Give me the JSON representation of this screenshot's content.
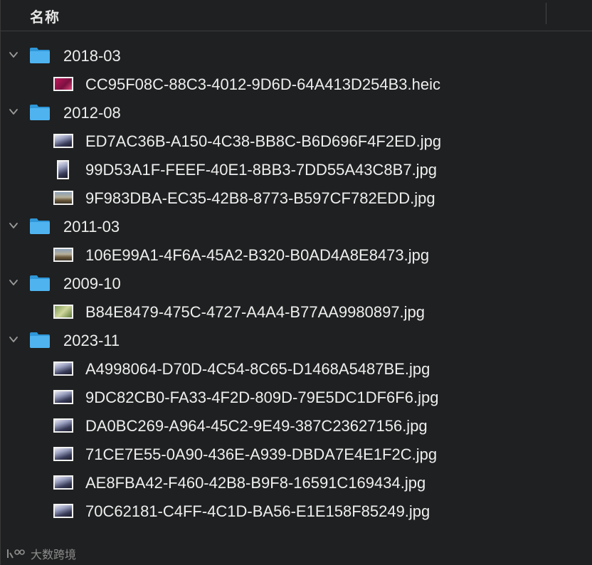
{
  "header": {
    "name_column": "名称"
  },
  "groups": [
    {
      "folder": "2018-03",
      "files": [
        {
          "name": "CC95F08C-88C3-4012-9D6D-64A413D254B3.heic",
          "thumb": "flower-thumbnail",
          "orientation": "landscape"
        }
      ]
    },
    {
      "folder": "2012-08",
      "files": [
        {
          "name": "ED7AC36B-A150-4C38-BB8C-B6D696F4F2ED.jpg",
          "thumb": "image-thumbnail",
          "orientation": "landscape"
        },
        {
          "name": "99D53A1F-FEEF-40E1-8BB3-7DD55A43C8B7.jpg",
          "thumb": "image-thumbnail",
          "orientation": "portrait"
        },
        {
          "name": "9F983DBA-EC35-42B8-8773-B597CF782EDD.jpg",
          "thumb": "landscape-thumbnail",
          "orientation": "landscape"
        }
      ]
    },
    {
      "folder": "2011-03",
      "files": [
        {
          "name": "106E99A1-4F6A-45A2-B320-B0AD4A8E8473.jpg",
          "thumb": "landscape-thumbnail",
          "orientation": "landscape"
        }
      ]
    },
    {
      "folder": "2009-10",
      "files": [
        {
          "name": "B84E8479-475C-4727-A4A4-B77AA9980897.jpg",
          "thumb": "nature-thumbnail",
          "orientation": "landscape"
        }
      ]
    },
    {
      "folder": "2023-11",
      "files": [
        {
          "name": "A4998064-D70D-4C54-8C65-D1468A5487BE.jpg",
          "thumb": "image-thumbnail",
          "orientation": "landscape"
        },
        {
          "name": "9DC82CB0-FA33-4F2D-809D-79E5DC1DF6F6.jpg",
          "thumb": "image-thumbnail",
          "orientation": "landscape"
        },
        {
          "name": "DA0BC269-A964-45C2-9E49-387C23627156.jpg",
          "thumb": "image-thumbnail",
          "orientation": "landscape"
        },
        {
          "name": "71CE7E55-0A90-436E-A939-DBDA7E4E1F2C.jpg",
          "thumb": "image-thumbnail",
          "orientation": "landscape"
        },
        {
          "name": "AE8FBA42-F460-42B8-B9F8-16591C169434.jpg",
          "thumb": "image-thumbnail",
          "orientation": "landscape"
        },
        {
          "name": "70C62181-C4FF-4C1D-BA56-E1E158F85249.jpg",
          "thumb": "image-thumbnail",
          "orientation": "landscape"
        }
      ]
    }
  ],
  "watermark": {
    "text": "大数跨境"
  },
  "colors": {
    "background": "#1f2021",
    "folder_blue": "#3fa9ea",
    "text": "#eeeeee",
    "chevron": "#9a9a9a"
  }
}
